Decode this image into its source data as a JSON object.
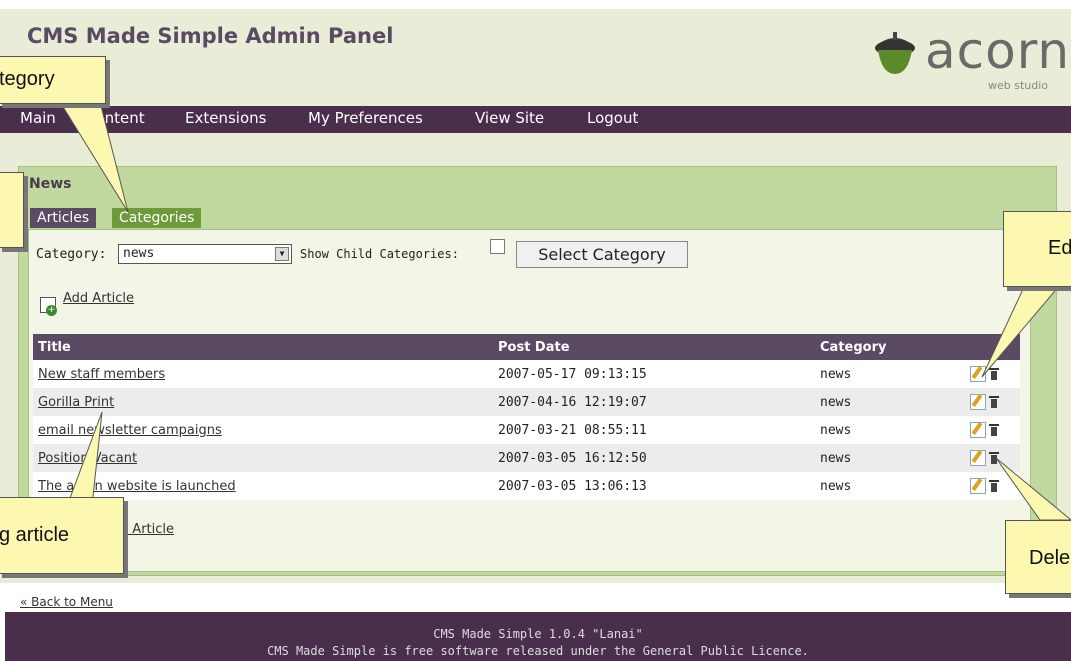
{
  "app_title": "CMS Made Simple Admin Panel",
  "logo": {
    "word": "acorn",
    "sub": "web studio"
  },
  "nav": [
    "Main",
    "Content",
    "Extensions",
    "My Preferences",
    "View Site",
    "Logout"
  ],
  "module": {
    "title": "News",
    "tabs": [
      "Articles",
      "Categories"
    ],
    "filter": {
      "category_label": "Category:",
      "category_value": "news",
      "show_child_label": "Show Child Categories:",
      "select_button": "Select Category"
    },
    "add_article": "Add Article",
    "table": {
      "headers": [
        "Title",
        "Post Date",
        "Category"
      ],
      "rows": [
        {
          "title": "New staff members",
          "date": "2007-05-17 09:13:15",
          "category": "news"
        },
        {
          "title": "Gorilla Print",
          "date": "2007-04-16 12:19:07",
          "category": "news"
        },
        {
          "title": "email newsletter campaigns",
          "date": "2007-03-21 08:55:11",
          "category": "news"
        },
        {
          "title": "Position Vacant",
          "date": "2007-03-05 16:12:50",
          "category": "news"
        },
        {
          "title": "The acorn website is launched",
          "date": "2007-03-05 13:06:13",
          "category": "news"
        }
      ]
    },
    "add_article_bottom": "Add Article"
  },
  "back_link": "« Back to Menu",
  "footer": {
    "line1": "CMS Made Simple 1.0.4 \"Lanai\"",
    "line2": "CMS Made Simple is free software released under the General Public Licence."
  },
  "callouts": {
    "category": "tegory",
    "edit": "Ed",
    "editing_article": "g article",
    "delete": "Dele"
  },
  "colors": {
    "nav": "#4a2f4c",
    "panel": "#c1d89f",
    "active_tab": "#6e9a3a",
    "callout": "#fdf8b0"
  }
}
